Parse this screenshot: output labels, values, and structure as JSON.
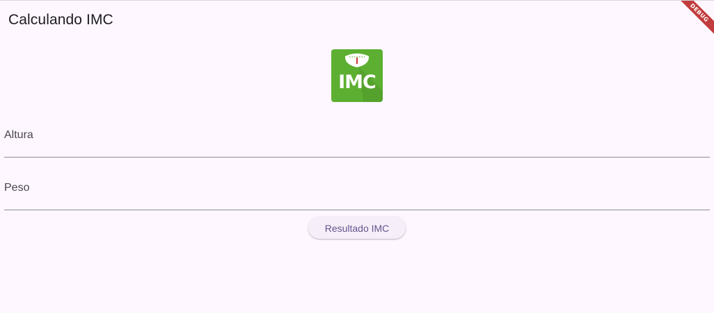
{
  "app": {
    "title": "Calculando IMC",
    "debug_banner": "DEBUG",
    "background_color": "#fef7ff"
  },
  "logo": {
    "icon": "scale-icon",
    "text": "IMC",
    "color": "#5daf31"
  },
  "form": {
    "height_label": "Altura",
    "height_value": "",
    "weight_label": "Peso",
    "weight_value": "",
    "submit_label": "Resultado IMC",
    "accent_color": "#65558f"
  }
}
